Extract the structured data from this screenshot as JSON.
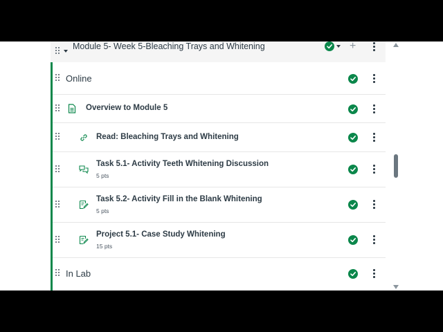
{
  "module": {
    "title": "Module 5- Week 5-Bleaching Trays and Whitening",
    "published": true
  },
  "items": [
    {
      "type": "subheader",
      "title": "Online",
      "icon": "none"
    },
    {
      "type": "page",
      "title": "Overview to Module 5",
      "icon": "document-icon"
    },
    {
      "type": "link",
      "title": "Read: Bleaching Trays and Whitening",
      "icon": "link-icon"
    },
    {
      "type": "discussion",
      "title": "Task 5.1- Activity Teeth Whitening Discussion",
      "points": "5 pts",
      "icon": "discussion-icon"
    },
    {
      "type": "assignment",
      "title": "Task 5.2- Activity Fill in the Blank Whitening",
      "points": "5 pts",
      "icon": "assignment-icon"
    },
    {
      "type": "assignment",
      "title": "Project 5.1- Case Study Whitening",
      "points": "15 pts",
      "icon": "assignment-icon"
    },
    {
      "type": "subheader",
      "title": "In Lab",
      "icon": "none"
    }
  ],
  "colors": {
    "published_green": "#0b874b",
    "text": "#2d3b45",
    "border": "#e6e6e6"
  }
}
